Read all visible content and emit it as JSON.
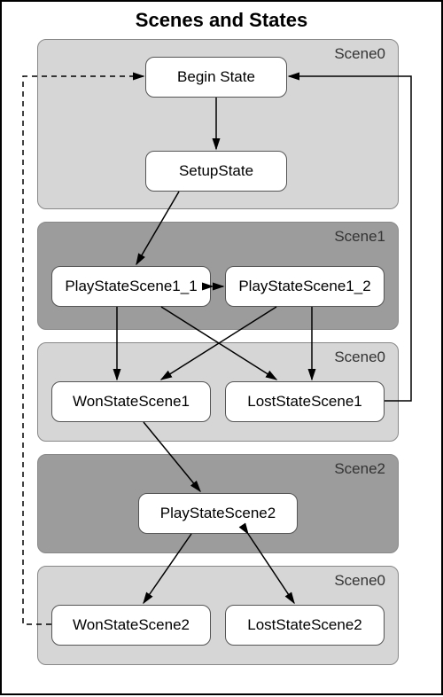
{
  "title": "Scenes and States",
  "scenes": {
    "s0a": "Scene0",
    "s1": "Scene1",
    "s0b": "Scene0",
    "s2": "Scene2",
    "s0c": "Scene0"
  },
  "states": {
    "begin": "Begin State",
    "setup": "SetupState",
    "ps1_1": "PlayStateScene1_1",
    "ps1_2": "PlayStateScene1_2",
    "won1": "WonStateScene1",
    "lost1": "LostStateScene1",
    "ps2": "PlayStateScene2",
    "won2": "WonStateScene2",
    "lost2": "LostStateScene2"
  },
  "chart_data": {
    "type": "state-diagram",
    "title": "Scenes and States",
    "containers": [
      {
        "id": "Scene0_a",
        "label": "Scene0",
        "states": [
          "Begin State",
          "SetupState"
        ]
      },
      {
        "id": "Scene1",
        "label": "Scene1",
        "states": [
          "PlayStateScene1_1",
          "PlayStateScene1_2"
        ]
      },
      {
        "id": "Scene0_b",
        "label": "Scene0",
        "states": [
          "WonStateScene1",
          "LostStateScene1"
        ]
      },
      {
        "id": "Scene2",
        "label": "Scene2",
        "states": [
          "PlayStateScene2"
        ]
      },
      {
        "id": "Scene0_c",
        "label": "Scene0",
        "states": [
          "WonStateScene2",
          "LostStateScene2"
        ]
      }
    ],
    "edges": [
      {
        "from": "Begin State",
        "to": "SetupState",
        "style": "solid"
      },
      {
        "from": "SetupState",
        "to": "PlayStateScene1_1",
        "style": "solid"
      },
      {
        "from": "PlayStateScene1_1",
        "to": "PlayStateScene1_2",
        "style": "solid",
        "bidirectional": true
      },
      {
        "from": "PlayStateScene1_1",
        "to": "WonStateScene1",
        "style": "solid"
      },
      {
        "from": "PlayStateScene1_1",
        "to": "LostStateScene1",
        "style": "solid"
      },
      {
        "from": "PlayStateScene1_2",
        "to": "WonStateScene1",
        "style": "solid"
      },
      {
        "from": "PlayStateScene1_2",
        "to": "LostStateScene1",
        "style": "solid"
      },
      {
        "from": "WonStateScene1",
        "to": "PlayStateScene2",
        "style": "solid"
      },
      {
        "from": "LostStateScene1",
        "to": "Begin State",
        "style": "solid"
      },
      {
        "from": "PlayStateScene2",
        "to": "WonStateScene2",
        "style": "solid"
      },
      {
        "from": "PlayStateScene2",
        "to": "LostStateScene2",
        "style": "solid",
        "bidirectional": true
      },
      {
        "from": "WonStateScene2",
        "to": "Begin State",
        "style": "dashed"
      }
    ]
  }
}
